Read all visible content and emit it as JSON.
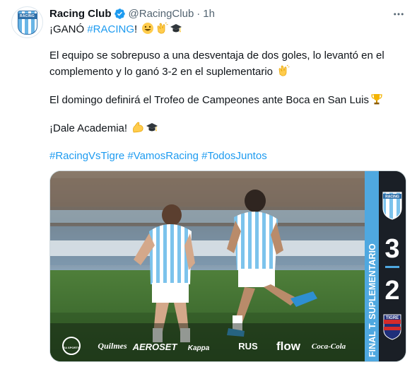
{
  "tweet": {
    "display_name": "Racing Club",
    "handle": "@RacingClub",
    "separator": "·",
    "time": "1h",
    "more_icon": "more-horizontal-icon",
    "avatar_text": "RACING",
    "line1_prefix": "¡GANÓ ",
    "line1_hashtag": "#RACING",
    "line1_suffix": "!",
    "line2a": "El equipo se sobrepuso a una desventaja de dos goles, lo levantó en el",
    "line2b": "complemento y lo ganó 3-2 en el suplementario",
    "line3": "El domingo definirá el Trofeo de Campeones ante Boca en San Luis",
    "line4": "¡Dale Academia!",
    "hashtags": [
      "#RacingVsTigre",
      "#VamosRacing",
      "#TodosJuntos"
    ]
  },
  "media": {
    "final_label": "FINAL T. SUPLEMENTARIO",
    "home_badge": "RACING",
    "home_score": "3",
    "away_score": "2",
    "away_badge": "TIGRE",
    "sponsors": [
      "EA SPORTS",
      "Quilmes",
      "AEROSET",
      "Kappa",
      "RUS",
      "flow",
      "Coca-Cola"
    ],
    "colors": {
      "panel": "#1a1f26",
      "accent": "#4fa8e0",
      "tigre_red": "#d42b2b",
      "tigre_blue": "#1f2f7a"
    }
  }
}
